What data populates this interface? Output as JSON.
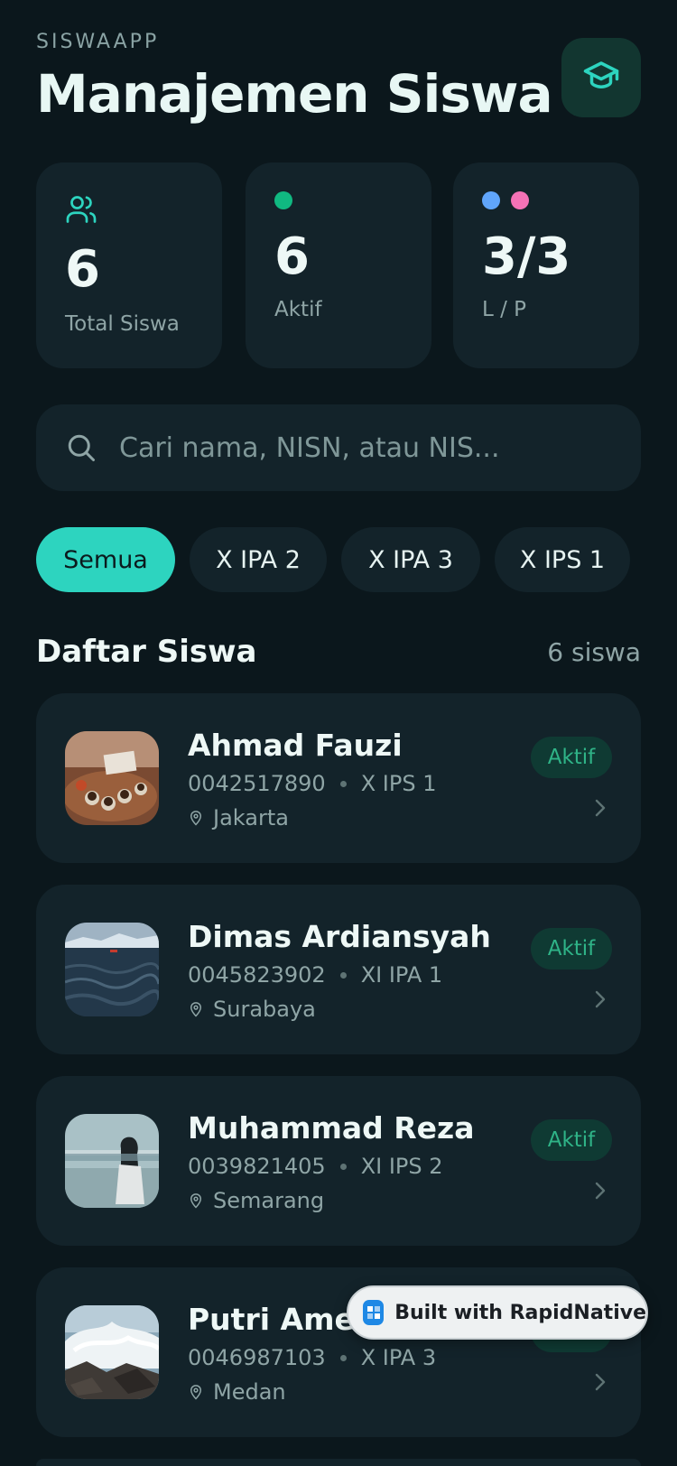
{
  "header": {
    "kicker": "SISWAAPP",
    "title": "Manajemen Siswa",
    "action_icon": "graduation-cap-icon"
  },
  "stats": [
    {
      "icon": "users-icon",
      "value": "6",
      "label": "Total Siswa"
    },
    {
      "icon": "green-dot",
      "value": "6",
      "label": "Aktif"
    },
    {
      "icon": "blue-pink-dots",
      "value": "3/3",
      "label": "L / P"
    }
  ],
  "search": {
    "placeholder": "Cari nama, NISN, atau NIS...",
    "value": ""
  },
  "filters": {
    "items": [
      "Semua",
      "X IPA 2",
      "X IPA 3",
      "X IPS 1"
    ],
    "active": "Semua"
  },
  "section": {
    "title": "Daftar Siswa",
    "count": "6 siswa"
  },
  "students": [
    {
      "name": "Ahmad Fauzi",
      "nisn": "0042517890",
      "class": "X IPS 1",
      "city": "Jakarta",
      "status": "Aktif",
      "photo": "coffee-cups-photo"
    },
    {
      "name": "Dimas Ardiansyah",
      "nisn": "0045823902",
      "class": "XI IPA 1",
      "city": "Surabaya",
      "status": "Aktif",
      "photo": "sea-waves-photo"
    },
    {
      "name": "Muhammad Reza",
      "nisn": "0039821405",
      "class": "XI IPS 2",
      "city": "Semarang",
      "status": "Aktif",
      "photo": "person-beach-photo"
    },
    {
      "name": "Putri Ameli",
      "nisn": "0046987103",
      "class": "X IPA 3",
      "city": "Medan",
      "status": "Aktif",
      "photo": "crashing-wave-photo"
    }
  ],
  "colors": {
    "background": "#0b171c",
    "card": "#13232a",
    "accent": "#2dd4bf",
    "status_green": "#2fb387",
    "male_dot": "#60a5fa",
    "female_dot": "#f472b6"
  },
  "badge": {
    "text": "Built with RapidNative"
  }
}
